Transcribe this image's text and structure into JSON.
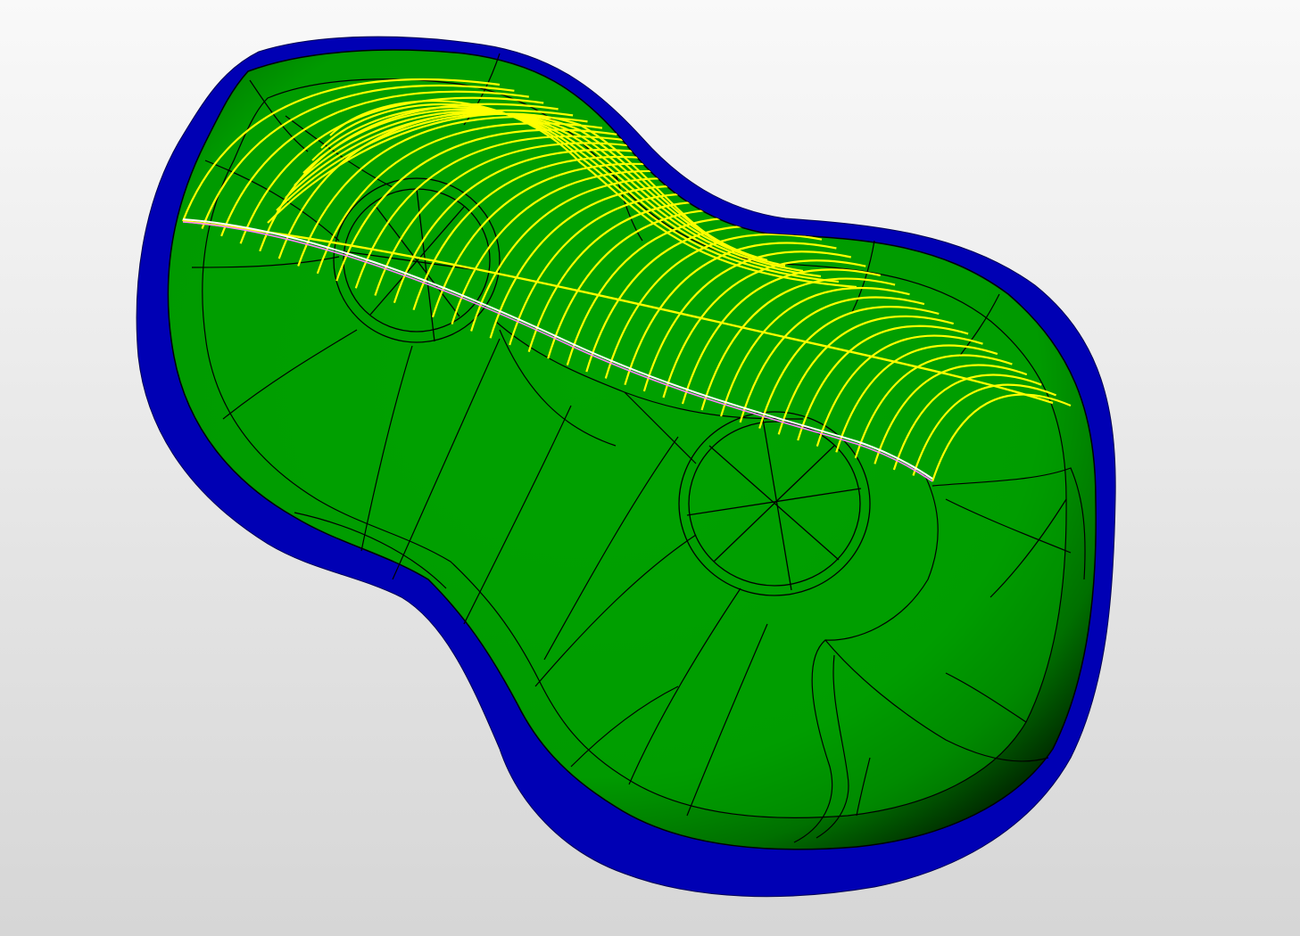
{
  "viewport": {
    "background_top": "#f9f9f9",
    "background_bottom": "#d6d6d6"
  },
  "model": {
    "base_color": "#0000b4",
    "surface_color": "#00a000",
    "edge_color": "#000000",
    "toolpath_color": "#ffff00",
    "section_curve_colors": [
      "#ff80ff",
      "#ffffff"
    ],
    "toolpath_pass_count": 40
  }
}
